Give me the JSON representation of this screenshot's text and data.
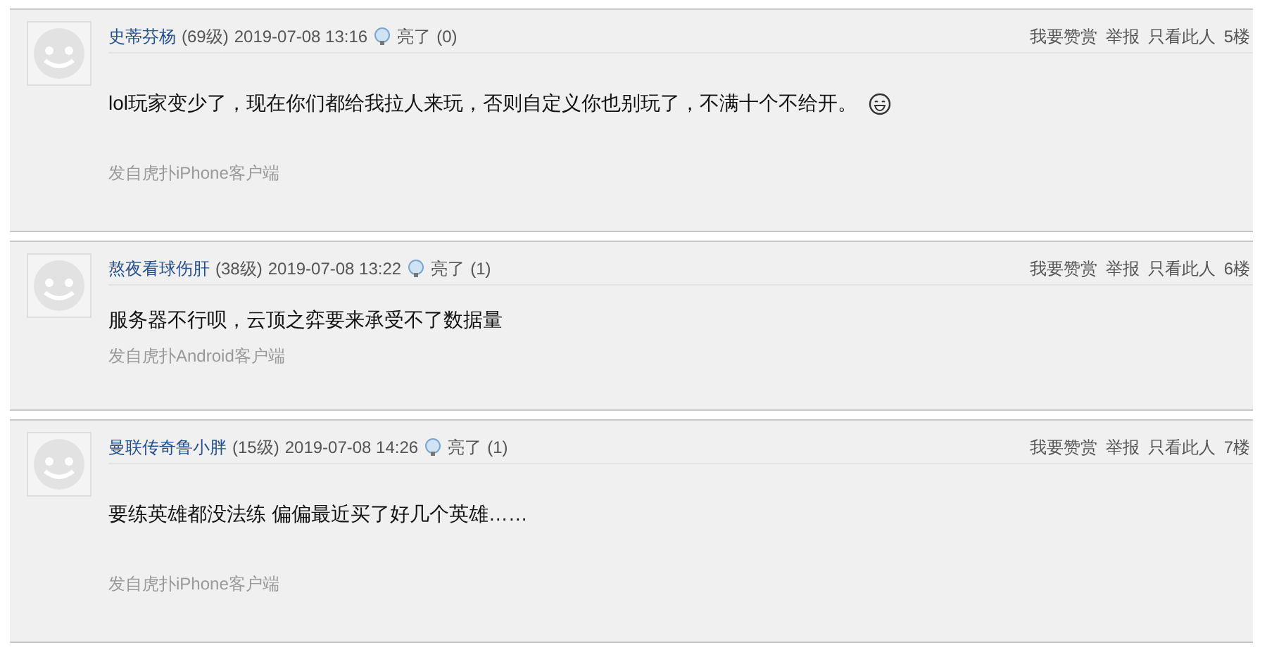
{
  "posts": [
    {
      "author": "史蒂芬杨",
      "level": "(69级)",
      "time": "2019-07-08 13:16",
      "light": "亮了",
      "light_count": "(0)",
      "actions": [
        "我要赞赏",
        "举报",
        "只看此人"
      ],
      "floor": "5楼",
      "content": "lol玩家变少了，现在你们都给我拉人来玩，否则自定义你也别玩了，不满十个不给开。",
      "emoticon": true,
      "source": "发自虎扑iPhone客户端"
    },
    {
      "author": "熬夜看球伤肝",
      "level": "(38级)",
      "time": "2019-07-08 13:22",
      "light": "亮了",
      "light_count": "(1)",
      "actions": [
        "我要赞赏",
        "举报",
        "只看此人"
      ],
      "floor": "6楼",
      "content": "服务器不行呗，云顶之弈要来承受不了数据量",
      "emoticon": false,
      "source": "发自虎扑Android客户端"
    },
    {
      "author": "曼联传奇鲁小胖",
      "level": "(15级)",
      "time": "2019-07-08 14:26",
      "light": "亮了",
      "light_count": "(1)",
      "actions": [
        "我要赞赏",
        "举报",
        "只看此人"
      ],
      "floor": "7楼",
      "content": "要练英雄都没法练 偏偏最近买了好几个英雄……",
      "emoticon": false,
      "source": "发自虎扑iPhone客户端"
    }
  ]
}
